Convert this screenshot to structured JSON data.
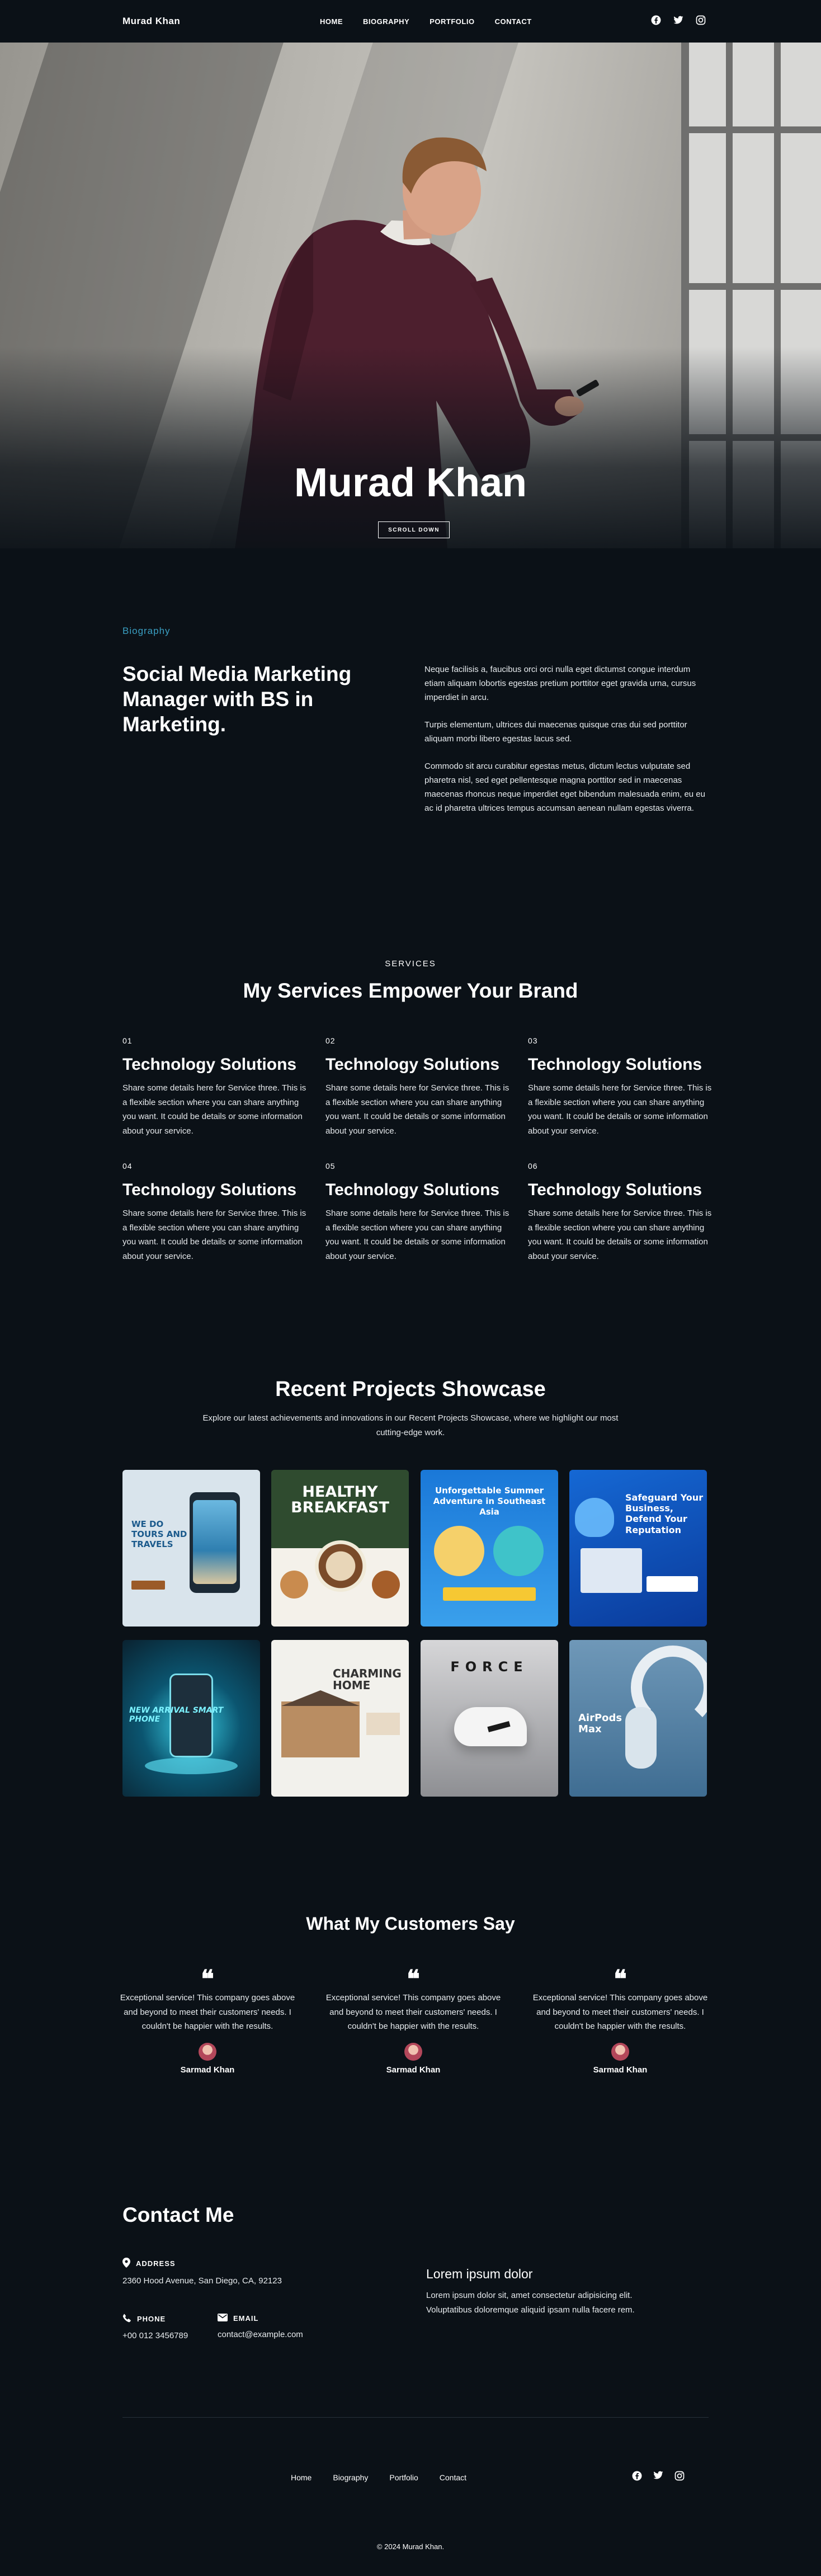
{
  "nav": {
    "brand": "Murad Khan",
    "links": [
      "HOME",
      "BIOGRAPHY",
      "PORTFOLIO",
      "CONTACT"
    ],
    "social_icons": [
      "facebook-icon",
      "twitter-icon",
      "instagram-icon"
    ]
  },
  "hero": {
    "name": "Murad Khan",
    "button": "SCROLL DOWN"
  },
  "biography": {
    "label": "Biography",
    "heading": "Social Media Marketing Manager with BS in Marketing.",
    "paragraphs": [
      "Neque facilisis a, faucibus orci orci nulla eget dictumst congue interdum etiam aliquam lobortis egestas pretium porttitor eget gravida urna, cursus imperdiet in arcu.",
      "Turpis elementum, ultrices dui maecenas quisque cras dui sed porttitor aliquam morbi libero egestas lacus sed.",
      "Commodo sit arcu curabitur egestas metus, dictum lectus vulputate sed pharetra nisl, sed eget pellentesque magna porttitor sed in maecenas maecenas rhoncus neque imperdiet eget bibendum malesuada enim, eu eu ac id pharetra ultrices tempus accumsan aenean nullam egestas viverra."
    ]
  },
  "services": {
    "label": "SERVICES",
    "title": "My Services Empower Your Brand",
    "items": [
      {
        "num": "01",
        "title": "Technology Solutions",
        "desc": "Share some details here for Service three. This is a flexible section where you can share anything you want. It could be details or some information about your service."
      },
      {
        "num": "02",
        "title": "Technology Solutions",
        "desc": "Share some details here for Service three. This is a flexible section where you can share anything you want. It could be details or some information about your service."
      },
      {
        "num": "03",
        "title": "Technology Solutions",
        "desc": "Share some details here for Service three. This is a flexible section where you can share anything you want. It could be details or some information about your service."
      },
      {
        "num": "04",
        "title": "Technology Solutions",
        "desc": "Share some details here for Service three. This is a flexible section where you can share anything you want. It could be details or some information about your service."
      },
      {
        "num": "05",
        "title": "Technology Solutions",
        "desc": "Share some details here for Service three. This is a flexible section where you can share anything you want. It could be details or some information about your service."
      },
      {
        "num": "06",
        "title": "Technology Solutions",
        "desc": "Share some details here for Service three. This is a flexible section where you can share anything you want. It could be details or some information about your service."
      }
    ]
  },
  "projects": {
    "title": "Recent Projects Showcase",
    "subtitle": "Explore our latest achievements and innovations in our Recent Projects Showcase, where we highlight our most cutting-edge work.",
    "cards": [
      {
        "text": "WE DO TOURS AND TRAVELS"
      },
      {
        "text": "HEALTHY BREAKFAST"
      },
      {
        "text": "Unforgettable Summer Adventure in Southeast Asia"
      },
      {
        "text": "Safeguard Your Business, Defend Your Reputation"
      },
      {
        "text": "NEW ARRIVAL SMART PHONE"
      },
      {
        "text": "CHARMING HOME"
      },
      {
        "text": "FORCE"
      },
      {
        "text": "AirPods Max"
      }
    ]
  },
  "testimonials": {
    "title": "What My Customers Say",
    "items": [
      {
        "quote": "Exceptional service! This company goes above and beyond to meet their customers' needs. I couldn't be happier with the results.",
        "name": "Sarmad Khan"
      },
      {
        "quote": "Exceptional service! This company goes above and beyond to meet their customers' needs. I couldn't be happier with the results.",
        "name": "Sarmad Khan"
      },
      {
        "quote": "Exceptional service! This company goes above and beyond to meet their customers' needs. I couldn't be happier with the results.",
        "name": "Sarmad Khan"
      }
    ]
  },
  "contact": {
    "title": "Contact Me",
    "address_label": "ADDRESS",
    "address": "2360 Hood Avenue, San Diego, CA, 92123",
    "phone_label": "PHONE",
    "phone": "+00 012 3456789",
    "email_label": "EMAIL",
    "email": "contact@example.com",
    "side_title": "Lorem ipsum dolor",
    "side_text": "Lorem ipsum dolor sit, amet consectetur adipisicing elit. Voluptatibus doloremque aliquid ipsam nulla facere rem."
  },
  "footer": {
    "links": [
      "Home",
      "Biography",
      "Portfolio",
      "Contact"
    ],
    "copyright": "© 2024 Murad Khan."
  }
}
